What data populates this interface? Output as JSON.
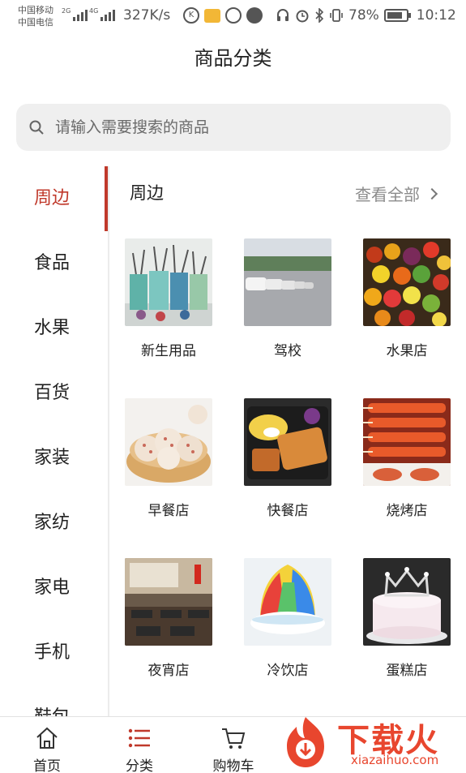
{
  "status_bar": {
    "carrier_1": "中国移动",
    "carrier_2": "中国电信",
    "net_1": "2G",
    "net_2": "4G",
    "speed": "327K/s",
    "battery": "78%",
    "time": "10:12"
  },
  "header": {
    "title": "商品分类"
  },
  "search": {
    "placeholder": "请输入需要搜索的商品"
  },
  "sidebar": {
    "items": [
      {
        "label": "周边",
        "active": true
      },
      {
        "label": "食品"
      },
      {
        "label": "水果"
      },
      {
        "label": "百货"
      },
      {
        "label": "家装"
      },
      {
        "label": "家纺"
      },
      {
        "label": "家电"
      },
      {
        "label": "手机"
      },
      {
        "label": "鞋包"
      }
    ]
  },
  "section": {
    "title": "周边",
    "view_all": "查看全部",
    "tiles": [
      {
        "label": "新生用品",
        "icon": "pens-in-cups-photo"
      },
      {
        "label": "驾校",
        "icon": "parked-cars-photo"
      },
      {
        "label": "水果店",
        "icon": "fruit-pile-photo"
      },
      {
        "label": "早餐店",
        "icon": "steamed-buns-photo"
      },
      {
        "label": "快餐店",
        "icon": "fastfood-plate-photo"
      },
      {
        "label": "烧烤店",
        "icon": "bbq-skewers-photo"
      },
      {
        "label": "夜宵店",
        "icon": "restaurant-interior-photo"
      },
      {
        "label": "冷饮店",
        "icon": "shaved-ice-photo"
      },
      {
        "label": "蛋糕店",
        "icon": "crown-cake-photo"
      }
    ]
  },
  "bottom_nav": {
    "items": [
      {
        "label": "首页",
        "icon": "home-icon"
      },
      {
        "label": "分类",
        "icon": "list-icon",
        "active": true
      },
      {
        "label": "购物车",
        "icon": "cart-icon"
      }
    ]
  },
  "watermark": {
    "text": "下载火",
    "url": "xiazaihuo.com"
  },
  "colors": {
    "accent": "#c0392b",
    "brand_watermark": "#e8462e"
  }
}
